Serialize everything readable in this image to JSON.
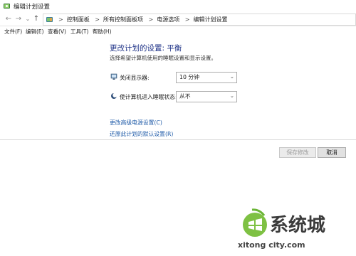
{
  "window": {
    "title": "编辑计划设置"
  },
  "nav": {
    "back_glyph": "←",
    "forward_glyph": "→",
    "dropdown_glyph": "⌄",
    "up_glyph": "↑"
  },
  "address": {
    "separator": ">",
    "crumbs": [
      "控制面板",
      "所有控制面板项",
      "电源选项",
      "编辑计划设置"
    ]
  },
  "menu": [
    "文件(F)",
    "编辑(E)",
    "查看(V)",
    "工具(T)",
    "帮助(H)"
  ],
  "main": {
    "heading": "更改计划的设置: 平衡",
    "subtitle": "选择希望计算机使用的睡眠设置和显示设置。",
    "settings": [
      {
        "label": "关闭显示器:",
        "value": "10 分钟",
        "icon": "monitor-icon"
      },
      {
        "label": "使计算机进入睡眠状态:",
        "value": "从不",
        "icon": "sleep-moon-icon"
      }
    ],
    "links": {
      "advanced": "更改高级电源设置(C)",
      "restore": "还原此计划的默认设置(R)"
    }
  },
  "buttons": {
    "save": "保存修改",
    "cancel": "取消"
  },
  "watermark": {
    "brand": "系统城",
    "domain": "xitong city.com"
  },
  "colors": {
    "heading": "#1e3287",
    "link": "#1f5ba8",
    "accent_green": "#7ec143"
  }
}
